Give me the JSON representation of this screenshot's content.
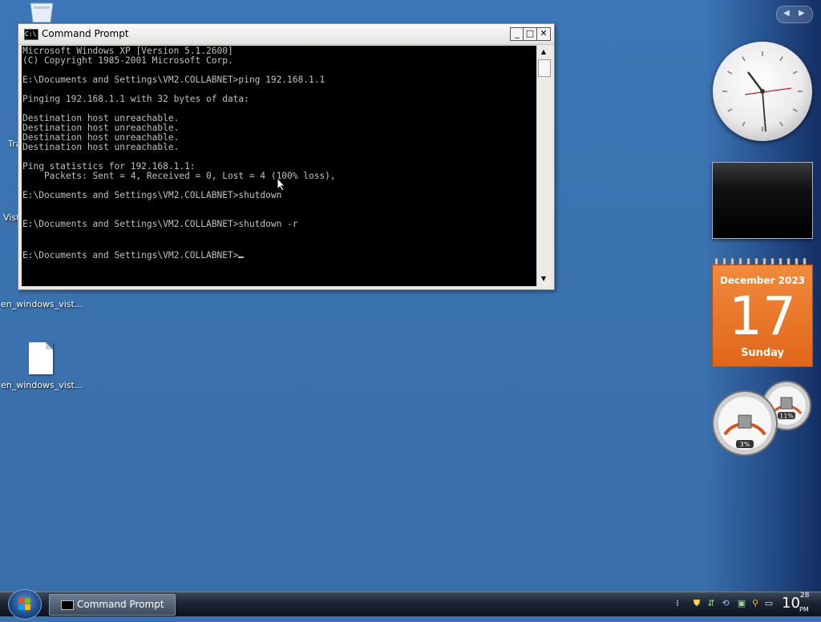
{
  "desktop": {
    "icons": [
      {
        "label": "en_windows_vist...",
        "type": "file"
      },
      {
        "label": "en_windows_vist...",
        "type": "file"
      }
    ],
    "partial_labels": [
      "Tra",
      "Vist"
    ]
  },
  "sidebar": {
    "nav_prev": "◀",
    "nav_next": "▶",
    "calendar": {
      "month": "December 2023",
      "day": "17",
      "weekday": "Sunday"
    },
    "meter": {
      "cpu": "3%",
      "memory": "11%"
    }
  },
  "cmd_window": {
    "title": "Command Prompt",
    "buttons": {
      "minimize": "_",
      "maximize": "□",
      "close": "✕"
    },
    "lines": [
      "Microsoft Windows XP [Version 5.1.2600]",
      "(C) Copyright 1985-2001 Microsoft Corp.",
      "",
      "E:\\Documents and Settings\\VM2.COLLABNET>ping 192.168.1.1",
      "",
      "Pinging 192.168.1.1 with 32 bytes of data:",
      "",
      "Destination host unreachable.",
      "Destination host unreachable.",
      "Destination host unreachable.",
      "Destination host unreachable.",
      "",
      "Ping statistics for 192.168.1.1:",
      "    Packets: Sent = 4, Received = 0, Lost = 4 (100% loss),",
      "",
      "E:\\Documents and Settings\\VM2.COLLABNET>shutdown",
      "",
      "",
      "E:\\Documents and Settings\\VM2.COLLABNET>shutdown -r",
      "",
      "",
      "E:\\Documents and Settings\\VM2.COLLABNET>"
    ]
  },
  "taskbar": {
    "task_label": "Command Prompt",
    "clock": {
      "hour": "10",
      "minute": "28",
      "ampm": "PM"
    }
  },
  "colors": {
    "desktop": "#3a73b2",
    "console_bg": "#000000",
    "console_text": "#c0c0c0",
    "calendar": "#e8731f"
  }
}
